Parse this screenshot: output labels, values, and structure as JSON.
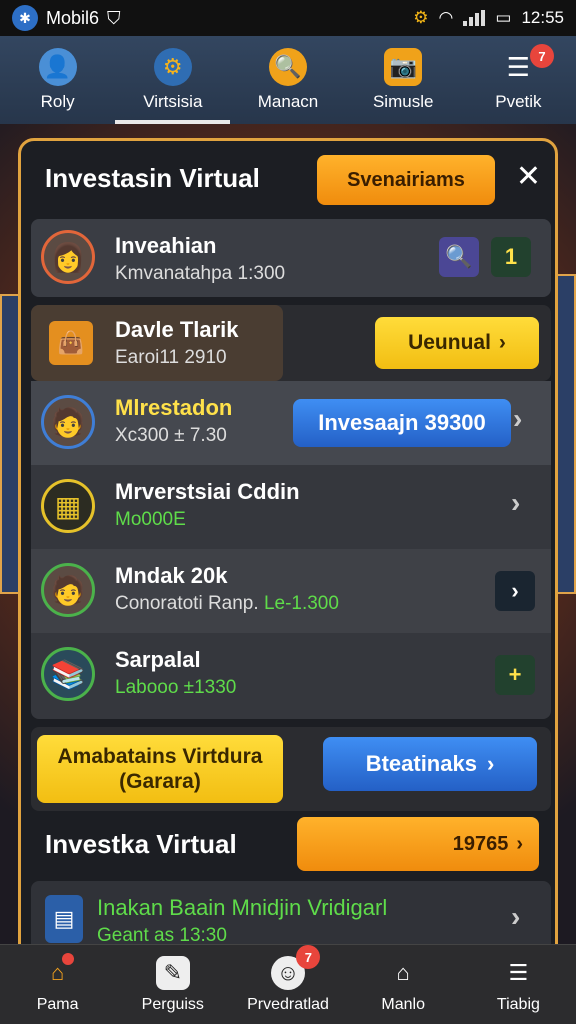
{
  "status_bar": {
    "carrier": "Mobil6",
    "time": "12:55"
  },
  "top_nav": {
    "items": [
      {
        "label": "Roly",
        "icon": "person-icon"
      },
      {
        "label": "Virtsisia",
        "icon": "gear-icon"
      },
      {
        "label": "Manacn",
        "icon": "search-icon"
      },
      {
        "label": "Simusle",
        "icon": "camera-icon"
      },
      {
        "label": "Pvetik",
        "icon": "menu-icon",
        "badge": "7"
      }
    ]
  },
  "panel": {
    "title": "Investasin Virtual",
    "header_button": "Svenairiams",
    "rows": [
      {
        "title": "Inveahian",
        "subtitle": "Kmvanatahpa 1:300",
        "button": "1"
      },
      {
        "title": "Davle Tlarik",
        "subtitle": "Earoi11 2910",
        "button": "Uеunual"
      },
      {
        "title": "Mlrestadon",
        "subtitle": "Xc300 ± 7.30",
        "button": "Invesaajn 39300"
      },
      {
        "title": "Mrverstsiai Cddin",
        "subtitle": "Mo000E"
      },
      {
        "title": "Mndak 20k",
        "subtitle": "Conoratoti Ranp.",
        "subtitle_green": "Le-1.300"
      },
      {
        "title": "Sarpalal",
        "subtitle": "Labooo ±1330"
      }
    ],
    "action_left": "Amabatains Virtdura (Garara)",
    "action_right": "Bteatinaks",
    "section_title": "Investka Virtual",
    "section_value": "19765",
    "last_row": {
      "title": "Inakan Baain Mnidjin Vridigarl",
      "subtitle": "Geant as 13:30"
    }
  },
  "bottom_nav": {
    "items": [
      {
        "label": "Pama",
        "icon": "home-icon"
      },
      {
        "label": "Perguiss",
        "icon": "chat-icon"
      },
      {
        "label": "Prvedratlad",
        "icon": "smile-icon",
        "badge": "7"
      },
      {
        "label": "Manlo",
        "icon": "school-icon"
      },
      {
        "label": "Tiabig",
        "icon": "list-icon"
      }
    ]
  },
  "colors": {
    "accent_orange": "#f5a21d",
    "accent_yellow": "#ffe14a",
    "accent_blue": "#3b82ec",
    "green_text": "#5fdc4a"
  }
}
